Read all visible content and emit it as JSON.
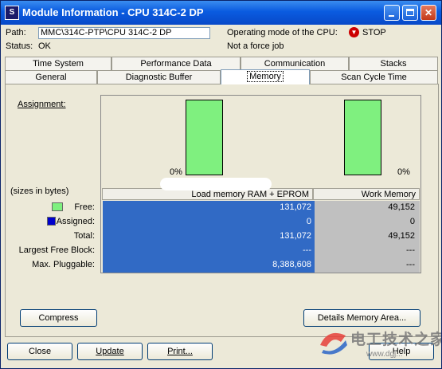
{
  "window": {
    "title": "Module Information - CPU 314C-2 DP",
    "app_icon_glyph": "S",
    "controls": {
      "minimize": "minimize-icon",
      "maximize": "maximize-icon",
      "close": "close-icon"
    }
  },
  "header": {
    "path_label": "Path:",
    "path_value": "MMC\\314C-PTP\\CPU 314C-2 DP",
    "status_label": "Status:",
    "status_value": "OK",
    "mode_label": "Operating mode of the CPU:",
    "mode_icon": "stop-sign-icon",
    "mode_value": "STOP",
    "force_text": "Not a force job"
  },
  "tabs": {
    "row1": [
      "Time System",
      "Performance Data",
      "Communication",
      "Stacks"
    ],
    "row2": [
      "General",
      "Diagnostic Buffer",
      "Memory",
      "Scan Cycle Time"
    ],
    "active": "Memory"
  },
  "memory": {
    "assignment_label": "Assignment:",
    "sizes_note": "(sizes in bytes)",
    "load_percent_label": "0%",
    "work_percent_label": "0%",
    "load_assigned_fraction": 0,
    "work_assigned_fraction": 0,
    "free_color": "#7ff07f",
    "assigned_color": "#0000cc",
    "columns": [
      "Load memory RAM + EPROM",
      "Work Memory"
    ],
    "rows": [
      {
        "label": "Free:",
        "load": "131,072",
        "work": "49,152"
      },
      {
        "label": "Assigned:",
        "load": "0",
        "work": "0"
      },
      {
        "label": "Total:",
        "load": "131,072",
        "work": "49,152"
      },
      {
        "label": "Largest Free Block:",
        "load": "---",
        "work": "---"
      },
      {
        "label": "Max. Pluggable:",
        "load": "8,388,608",
        "work": "---"
      }
    ]
  },
  "buttons": {
    "compress": "Compress",
    "details": "Details Memory Area...",
    "close": "Close",
    "update": "Update",
    "print": "Print...",
    "help": "Help"
  },
  "watermark": {
    "text_cn": "电工技术之家",
    "url": "www.dgj..."
  }
}
